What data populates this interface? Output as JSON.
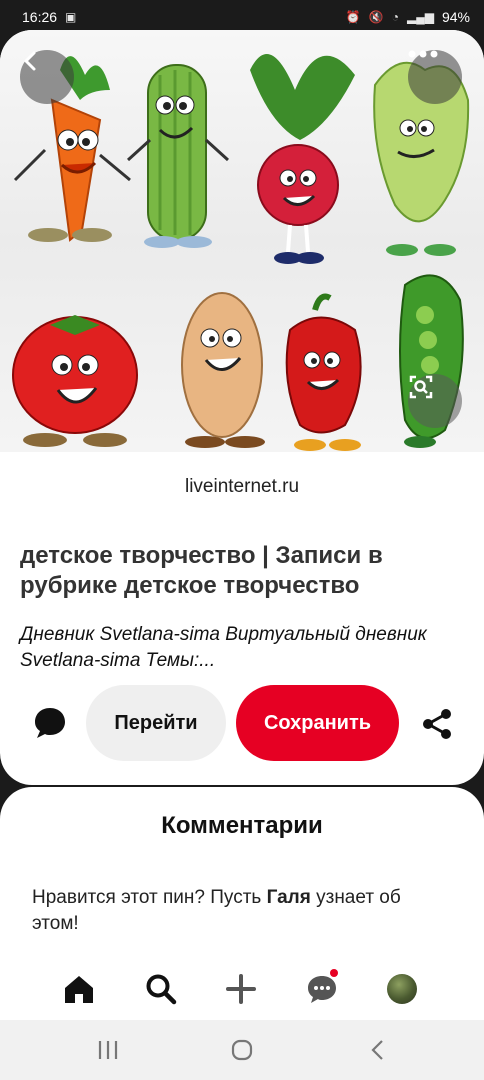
{
  "status_bar": {
    "time": "16:26",
    "battery": "94%"
  },
  "pin": {
    "source_domain": "liveinternet.ru",
    "title": "детское творчество | Записи в рубрике детское творчество",
    "description": "Дневник Svetlana-sima Виртуальный дневник Svetlana-sima Темы:...",
    "actions": {
      "go_label": "Перейти",
      "save_label": "Сохранить"
    }
  },
  "comments": {
    "title": "Комментарии",
    "prompt_before": "Нравится этот пин? Пусть ",
    "prompt_name": "Галя",
    "prompt_after": " узнает об этом!"
  },
  "bottom_nav": {
    "items": [
      {
        "icon": "home-icon"
      },
      {
        "icon": "search-icon"
      },
      {
        "icon": "add-icon"
      },
      {
        "icon": "messages-icon",
        "has_badge": true
      },
      {
        "icon": "profile-avatar"
      }
    ]
  },
  "colors": {
    "accent": "#e60023",
    "secondary_button": "#efefef",
    "dark_bg": "#1b1b1b"
  }
}
